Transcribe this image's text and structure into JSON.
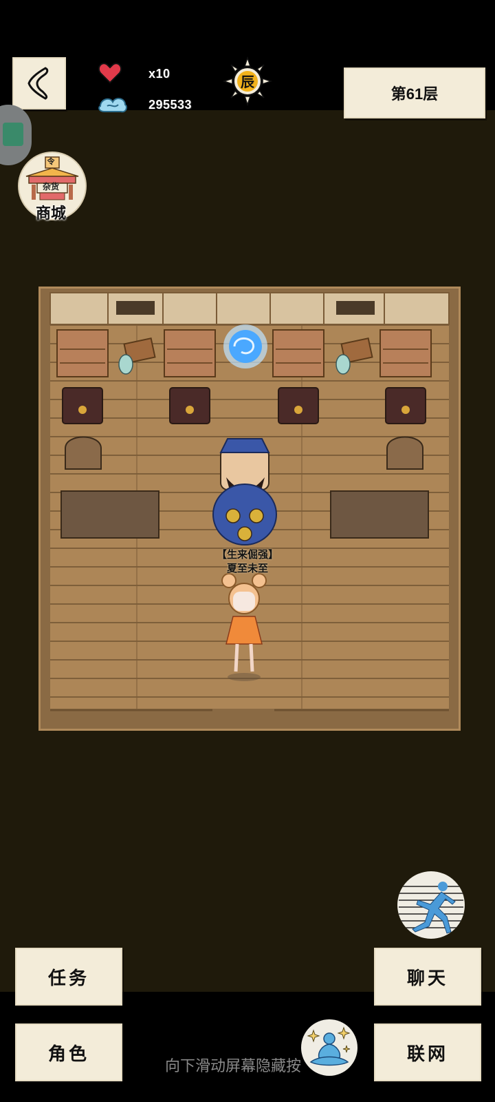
{
  "status": {
    "lives": "x10",
    "coins": "295533",
    "time_char": "辰"
  },
  "floor": {
    "label": "第61层"
  },
  "shop": {
    "label": "商城",
    "sign_top": "令",
    "sign_main": "杂货"
  },
  "npc": {
    "title": "【生来倔强】",
    "name": "夏至未至"
  },
  "actions": {
    "quest": "任务",
    "chat": "聊天",
    "role": "角色",
    "network": "联网"
  },
  "hint": "向下滑动屏幕隐藏按",
  "icons": {
    "back": "chevron-left-icon",
    "heart": "heart-icon",
    "coin": "cloud-coin-icon",
    "sun": "sun-icon",
    "sprint": "running-man-icon",
    "meditate": "meditation-icon"
  },
  "colors": {
    "background": "#1f1a0b",
    "paper": "#f3ecd9",
    "floor_wood": "#8a6a44",
    "heart": "#e23a4a",
    "portal": "#4aa8ff"
  }
}
